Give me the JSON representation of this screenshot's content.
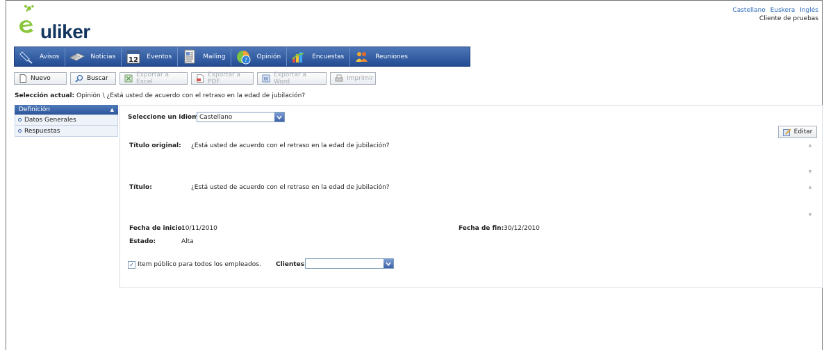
{
  "app": {
    "logo_text": "uliker"
  },
  "topbar": {
    "languages": [
      "Castellano",
      "Euskera",
      "Inglés"
    ],
    "client": "Cliente de pruebas"
  },
  "nav": {
    "items": [
      {
        "label": "Avisos",
        "icon": "pin-icon"
      },
      {
        "label": "Noticias",
        "icon": "newspaper-icon"
      },
      {
        "label": "Eventos",
        "icon": "calendar-icon",
        "icon_text": "12"
      },
      {
        "label": "Mailing",
        "icon": "document-icon"
      },
      {
        "label": "Opinión",
        "icon": "opinion-globe-icon"
      },
      {
        "label": "Encuestas",
        "icon": "survey-chart-icon"
      },
      {
        "label": "Reuniones",
        "icon": "people-icon"
      }
    ]
  },
  "toolbar": {
    "nuevo": "Nuevo",
    "buscar": "Buscar",
    "excel": "Exportar a Excel",
    "pdf": "Exportar a PDF",
    "word": "Exportar a Word",
    "imprimir": "Imprimir"
  },
  "selection": {
    "label": "Selección actual:",
    "path": "Opinión \\ ¿Está usted de acuerdo con el retraso en la edad de jubilación?"
  },
  "sidebar": {
    "header": "Definición",
    "items": [
      {
        "label": "Datos Generales"
      },
      {
        "label": "Respuestas"
      }
    ]
  },
  "form": {
    "idioma_label": "Seleccione un idioma:",
    "idioma_value": "Castellano",
    "edit_label": "Editar",
    "titulo_original_label": "Título original:",
    "titulo_original_value": "¿Está usted de acuerdo con el retraso en la edad de jubilación?",
    "titulo_label": "Título:",
    "titulo_value": "¿Está usted de acuerdo con el retraso en la edad de jubilación?",
    "fecha_inicio_label": "Fecha de inicio:",
    "fecha_inicio_value": "10/11/2010",
    "fecha_fin_label": "Fecha de fin:",
    "fecha_fin_value": "30/12/2010",
    "estado_label": "Estado:",
    "estado_value": "Alta",
    "publico_label": "Item público para todos los empleados.",
    "publico_checked": true,
    "clientes_label": "Clientes:",
    "clientes_value": ""
  },
  "colors": {
    "nav_bg": "#2f5aa0",
    "link": "#2a6ab7"
  }
}
